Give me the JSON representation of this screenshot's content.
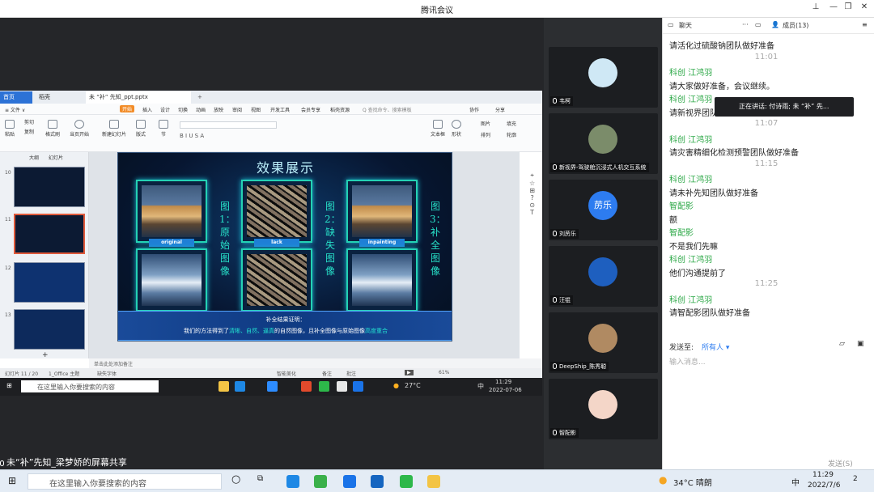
{
  "app": {
    "title": "腾讯会议"
  },
  "ppt": {
    "tabs": [
      "首页",
      "稻壳",
      "未 “补” 先知_ppt.pptx"
    ],
    "menu": [
      "≡ 文件 ∨",
      "开始",
      "插入",
      "设计",
      "切换",
      "动画",
      "放映",
      "审阅",
      "视图",
      "开发工具",
      "会员专享",
      "稻壳资源",
      "Q 查找命令、搜索模板",
      "协作",
      "分享"
    ],
    "ribbon": [
      "粘贴",
      "剪切",
      "复制",
      "格式刷",
      "当页开始",
      "新建幻灯片",
      "版式",
      "节",
      "文本框",
      "形状",
      "排列",
      "图片",
      "填充",
      "轮廓"
    ],
    "panel_tabs": [
      "大纲",
      "幻灯片"
    ],
    "slide_numbers": [
      "10",
      "11",
      "12",
      "13"
    ],
    "notes": "单击此处添加备注",
    "status": {
      "slide": "幻灯片 11 / 20",
      "theme": "1_Office 主题",
      "font": "缺失字体",
      "beautify": "智能美化",
      "notes_btn": "备注",
      "comment": "批注",
      "zoom": "61%"
    },
    "slide": {
      "title": "效果展示",
      "captions": [
        "图1：原始图像",
        "图2：缺失图像",
        "图3：补全图像"
      ],
      "labels": [
        "original",
        "lack",
        "inpainting"
      ],
      "footer_line1": "补全结果证明：",
      "footer_pre": "我们的方法得到了",
      "footer_hl1": "清晰、自然、逼真",
      "footer_mid": "的自然图像，且补全图像与原始图像",
      "footer_hl2": "高度重合"
    }
  },
  "inner_taskbar": {
    "search": "在这里输入你要搜索的内容",
    "weather": "27°C",
    "time": "11:29",
    "date": "2022-07-06",
    "ime": "中"
  },
  "share_label": "未“补”先知_梁梦娇的屏幕共享",
  "participants": [
    {
      "name": "韦柯"
    },
    {
      "name": "新视界-驾驶舱沉浸式人机交互系统"
    },
    {
      "name": "刘苈乐",
      "initials": "苈乐"
    },
    {
      "name": "汪锟"
    },
    {
      "name": "DeepShip_陈秀聪"
    },
    {
      "name": "智配影"
    }
  ],
  "chat": {
    "tab_chat": "聊天",
    "tab_members": "成员(13)",
    "speaking": "正在讲话: 付诗雨; 未 “补” 先...",
    "messages": [
      {
        "kind": "text",
        "text": "请活化过硫酸钠团队做好准备"
      },
      {
        "kind": "time",
        "text": "11:01"
      },
      {
        "kind": "sender",
        "text": "科创 江鸿羽"
      },
      {
        "kind": "text",
        "text": "请大家做好准备，会议继续。"
      },
      {
        "kind": "sender",
        "text": "科创 江鸿羽"
      },
      {
        "kind": "text",
        "text": "请新视界团队做好准备"
      },
      {
        "kind": "time",
        "text": "11:07"
      },
      {
        "kind": "sender",
        "text": "科创 江鸿羽"
      },
      {
        "kind": "text",
        "text": "请灾害精细化检测预警团队做好准备"
      },
      {
        "kind": "time",
        "text": "11:15"
      },
      {
        "kind": "sender",
        "text": "科创 江鸿羽"
      },
      {
        "kind": "text",
        "text": "请未补先知团队做好准备"
      },
      {
        "kind": "sender",
        "text": "智配影"
      },
      {
        "kind": "text",
        "text": "额"
      },
      {
        "kind": "sender",
        "text": "智配影"
      },
      {
        "kind": "text",
        "text": "不是我们先嘛"
      },
      {
        "kind": "sender",
        "text": "科创 江鸿羽"
      },
      {
        "kind": "text",
        "text": "他们沟通提前了"
      },
      {
        "kind": "time",
        "text": "11:25"
      },
      {
        "kind": "sender",
        "text": "科创 江鸿羽"
      },
      {
        "kind": "text",
        "text": "请智配影团队做好准备"
      }
    ],
    "send_to_label": "发送至:",
    "send_to_value": "所有人 ▾",
    "input_placeholder": "输入消息...",
    "send_button": "发送(S)"
  },
  "taskbar": {
    "search_placeholder": "在这里输入你要搜索的内容",
    "weather": "34°C 晴朗",
    "ime": "中",
    "time": "11:29",
    "date": "2022/7/6",
    "notif": "2"
  },
  "colors": {
    "accent": "#2d7cf0",
    "sender_green": "#2aa745",
    "slide_cyan": "#27e0c8"
  }
}
